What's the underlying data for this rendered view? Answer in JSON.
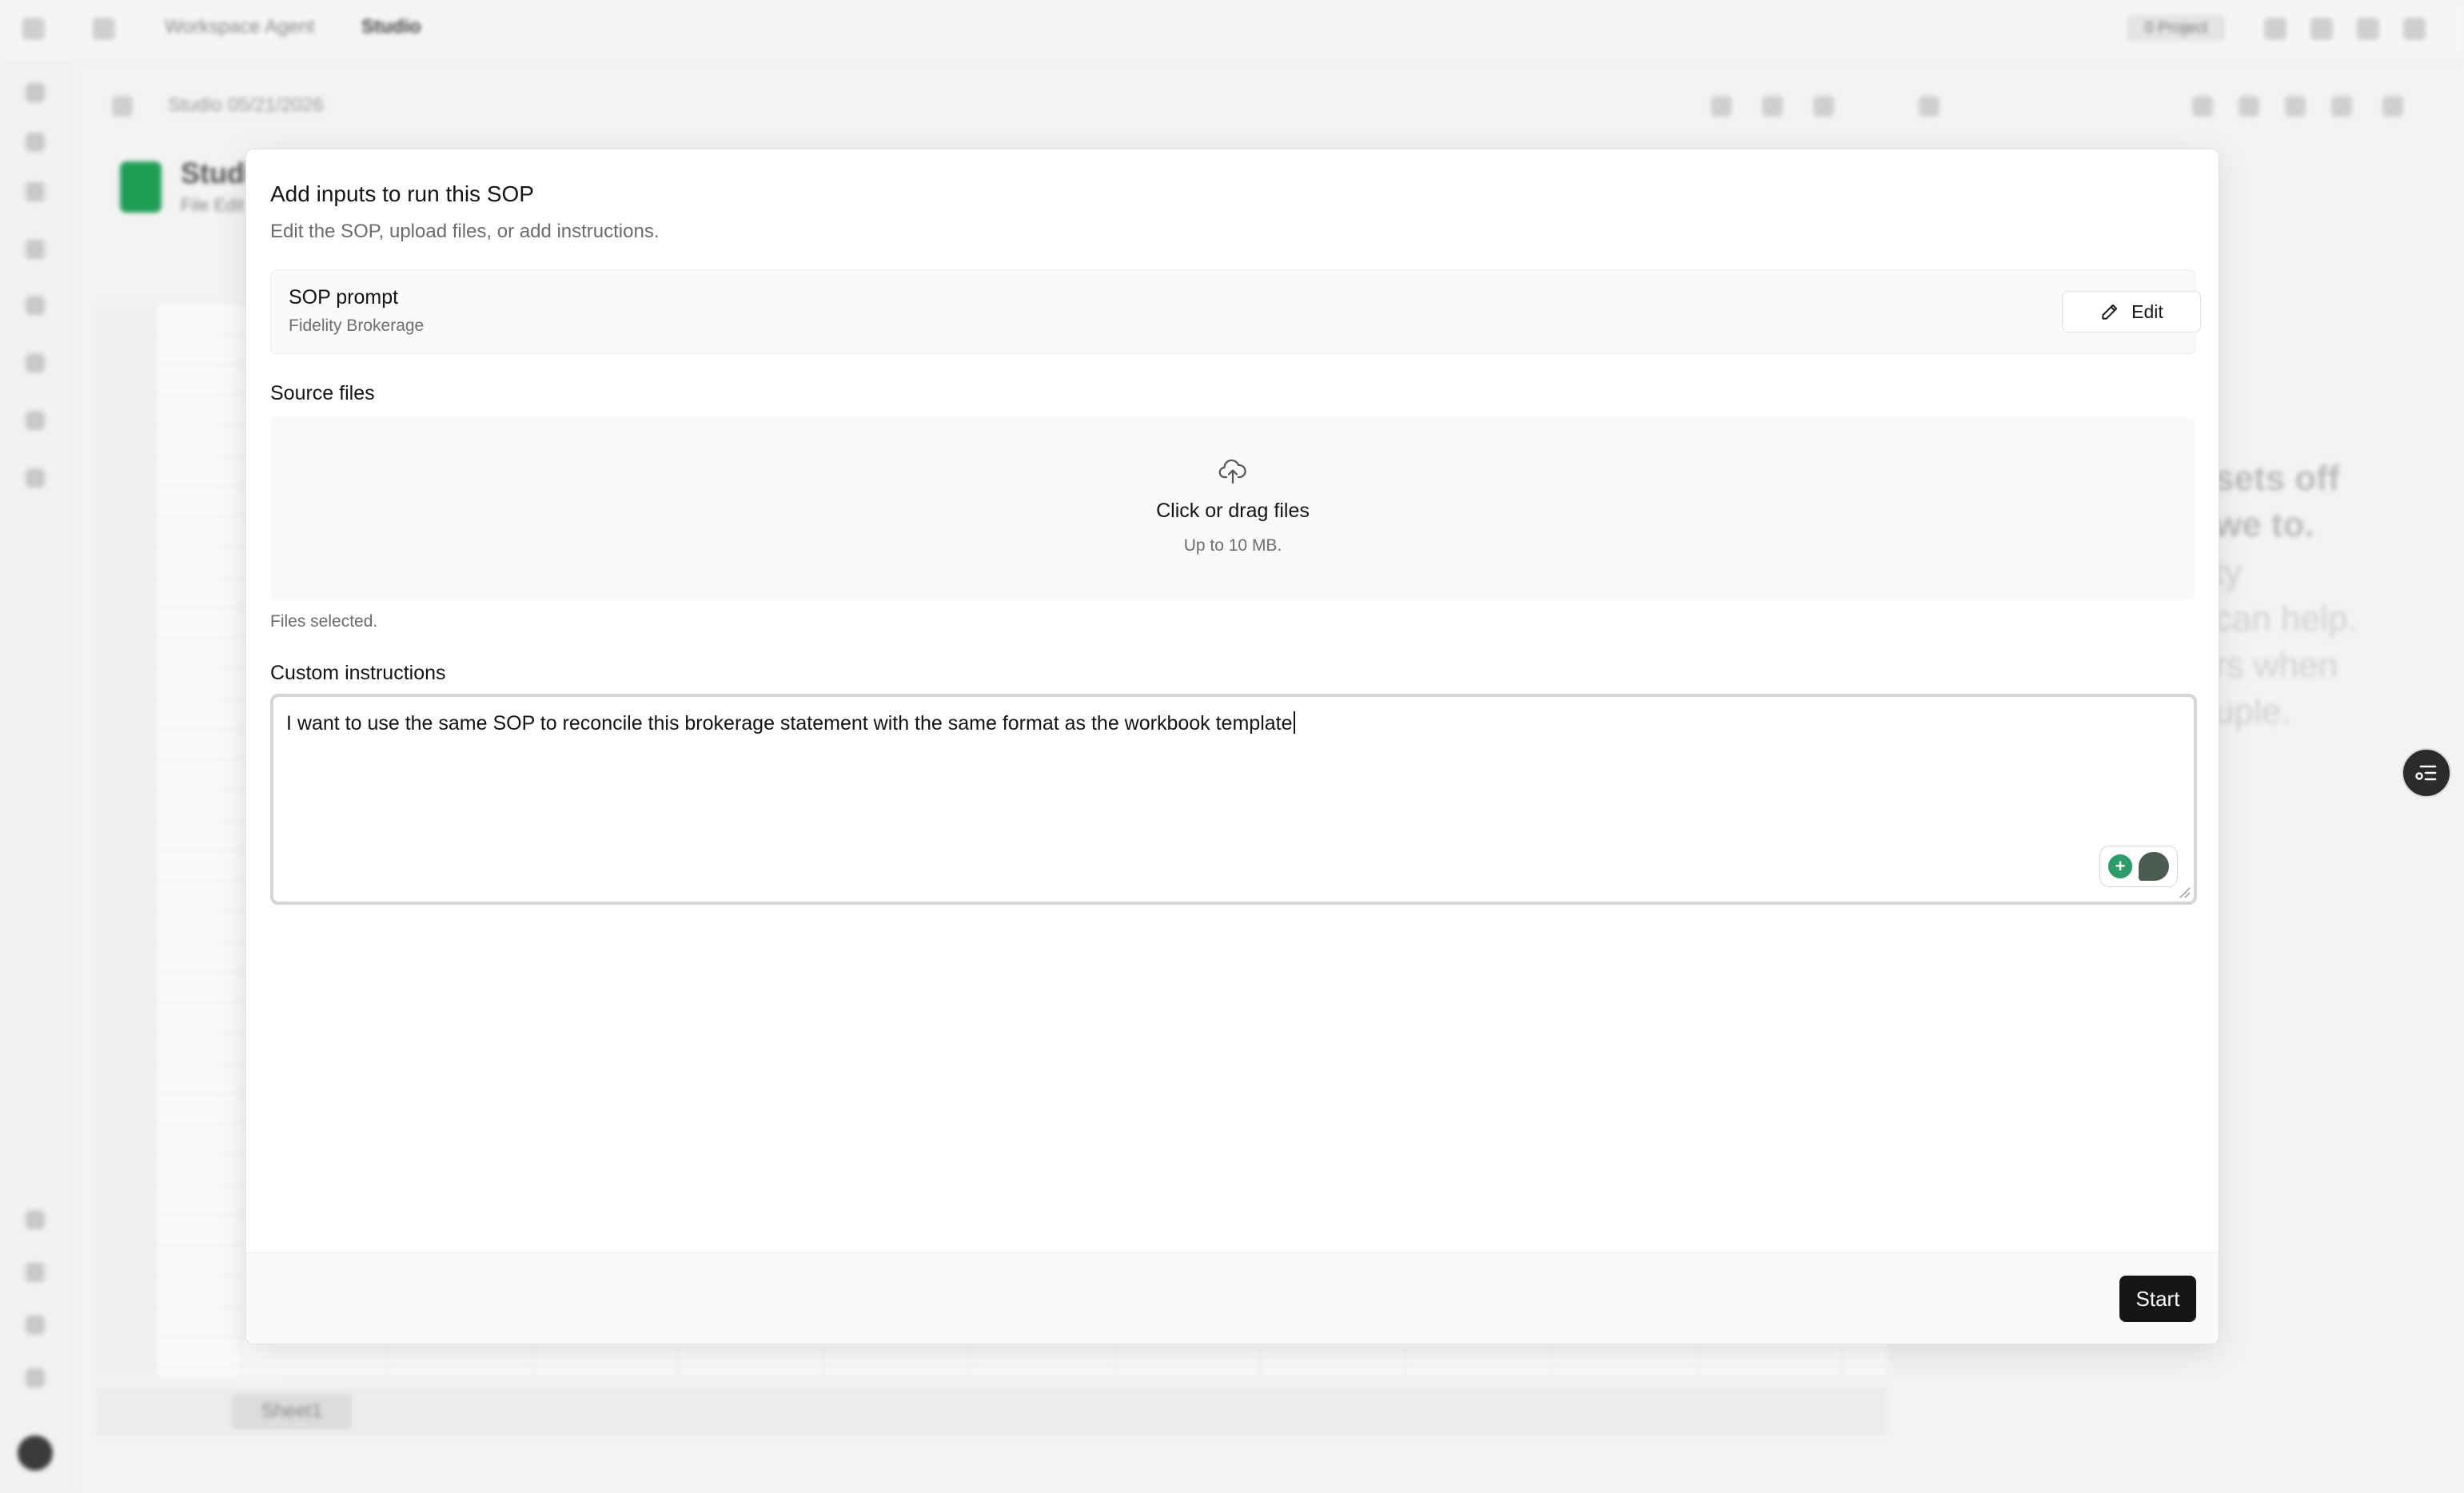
{
  "app": {
    "breadcrumb": [
      "Workspace Agent",
      "Studio"
    ],
    "doc_title": "Studio 05/21/2026",
    "sheet_name": "Studio",
    "sheet_menu": "File   Edit",
    "sheet_tab": "Sheet1",
    "pill_right": "0 Project",
    "right_panel_heading": "sets off\nwe to.",
    "right_panel_body": "ty\ncan help.\nrs when\nuple."
  },
  "modal": {
    "title": "Add inputs to run this SOP",
    "subtitle": "Edit the SOP, upload files, or add instructions.",
    "sop": {
      "label": "SOP prompt",
      "value": "Fidelity Brokerage",
      "edit_label": "Edit"
    },
    "source_files": {
      "label": "Source files",
      "dropzone_title": "Click or drag files",
      "dropzone_sub": "Up to 10 MB.",
      "status": "Files selected."
    },
    "custom_instructions": {
      "label": "Custom instructions",
      "value": "I want to use the same SOP to reconcile this brokerage statement with the same format as the workbook template"
    },
    "start_label": "Start"
  },
  "colors": {
    "primary_button": "#161616",
    "grammar_green": "#2e9b6a",
    "sheet_green": "#1f9d55"
  },
  "icons": [
    "pencil-icon",
    "upload-cloud-icon",
    "grammar-check-icon",
    "chat-bubble-icon",
    "resize-handle-icon",
    "assistant-toggle-icon"
  ]
}
